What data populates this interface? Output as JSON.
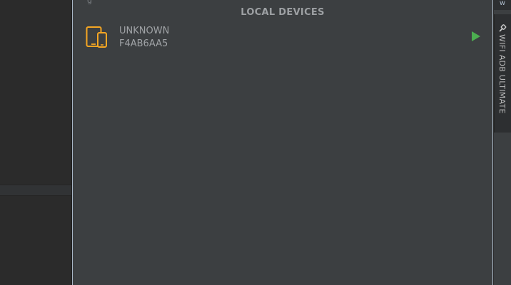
{
  "panel": {
    "top_cut_text": "g",
    "section_title": "LOCAL DEVICES",
    "devices": [
      {
        "name": "UNKNOWN",
        "serial": "F4AB6AA5",
        "icon": "phone-tablet-icon",
        "action_icon": "play-icon"
      }
    ]
  },
  "right_toolbar": {
    "top_tab_label": "w",
    "plugin_tab_label": "WIFI ADB ULTIMATE",
    "plugin_tab_icon": "wifi-adb-icon"
  },
  "colors": {
    "device_icon": "#f5a623",
    "play": "#4caf50",
    "panel_bg": "#3c3f41"
  }
}
